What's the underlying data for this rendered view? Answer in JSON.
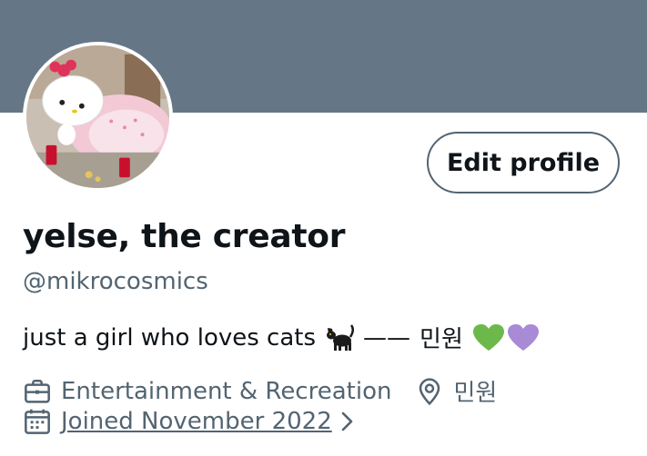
{
  "profile": {
    "display_name": "yelse, the creator",
    "handle": "@mikrocosmics",
    "bio_text": "just a girl who loves cats",
    "bio_dash": "——",
    "bio_name": "민원",
    "location": "민원",
    "category": "Entertainment & Recreation",
    "joined": "Joined November 2022"
  },
  "actions": {
    "edit_profile_label": "Edit profile"
  },
  "colors": {
    "banner": "#657786",
    "text_primary": "#0f1419",
    "text_secondary": "#536471",
    "heart_green": "#6cb84b",
    "heart_purple": "#a98ad6"
  },
  "icons": {
    "category": "briefcase-icon",
    "location": "location-pin-icon",
    "joined": "calendar-icon",
    "chevron": "chevron-right-icon",
    "cat": "black-cat-emoji",
    "green_heart": "green-heart-emoji",
    "purple_heart": "purple-heart-emoji"
  }
}
